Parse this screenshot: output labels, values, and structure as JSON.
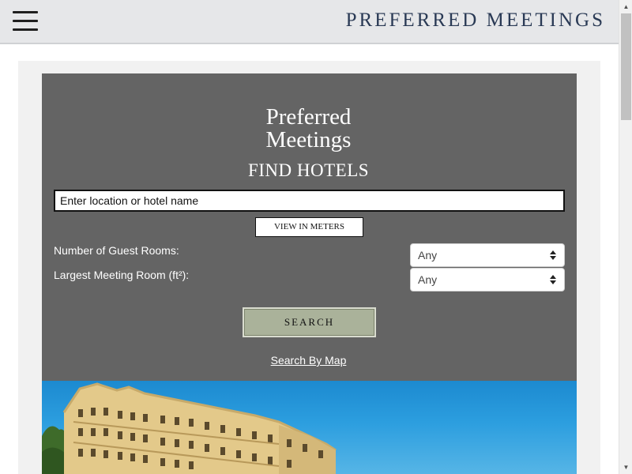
{
  "header": {
    "brand": "PREFERRED MEETINGS",
    "menu_icon": "hamburger-icon"
  },
  "search_panel": {
    "logo_line1": "Preferred",
    "logo_line2": "Meetings",
    "heading": "FIND HOTELS",
    "location_placeholder": "Enter location or hotel name",
    "location_value": "",
    "units_button": "VIEW IN METERS",
    "guest_rooms_label": "Number of Guest Rooms:",
    "guest_rooms_value": "Any",
    "meeting_room_label": "Largest Meeting Room (ft²):",
    "meeting_room_value": "Any",
    "search_button": "SEARCH",
    "map_link": "Search By Map"
  },
  "colors": {
    "panel": "#646464",
    "brand_text": "#2a3a55",
    "search_button": "#aab29a"
  },
  "icons": [
    "hamburger-icon",
    "select-arrows-icon",
    "scroll-up-icon",
    "scroll-down-icon"
  ]
}
